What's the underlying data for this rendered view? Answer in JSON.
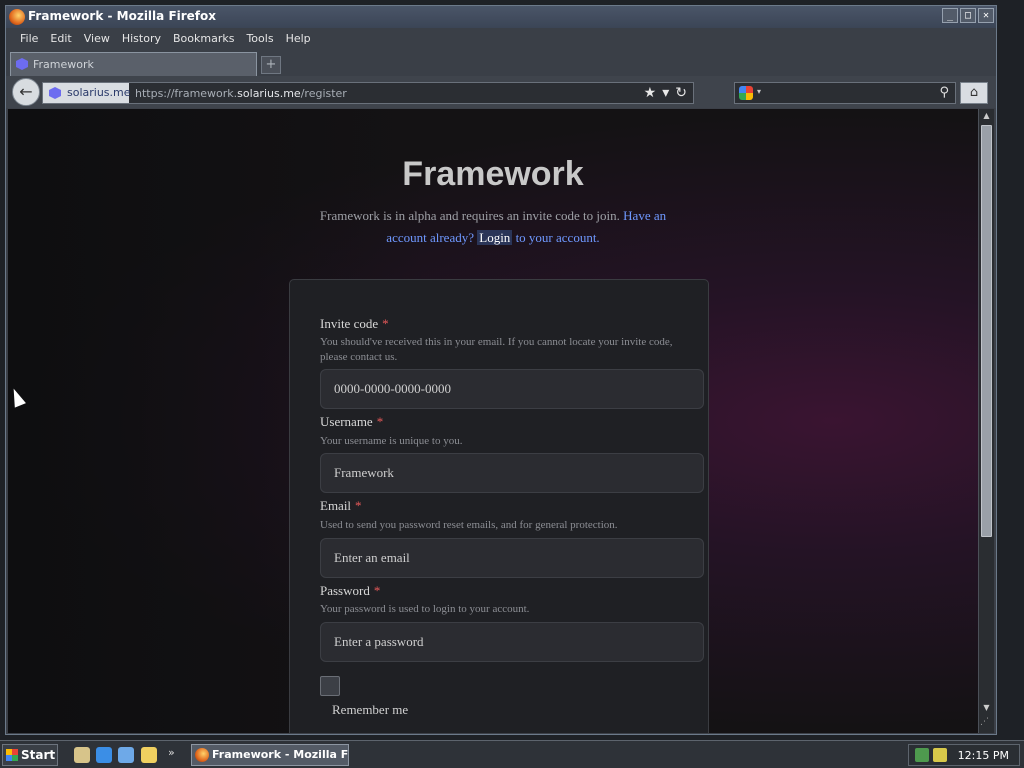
{
  "window": {
    "title": "Framework - Mozilla Firefox",
    "buttons": {
      "minimize": "_",
      "maximize": "□",
      "close": "✕"
    }
  },
  "menu": [
    "File",
    "Edit",
    "View",
    "History",
    "Bookmarks",
    "Tools",
    "Help"
  ],
  "tab": {
    "label": "Framework",
    "new_tab": "+"
  },
  "nav": {
    "back": "←",
    "site_identity": "solarius.me",
    "url_prefix": "https://framework.",
    "url_host": "solarius.me",
    "url_path": "/register",
    "bookmark_star": "★",
    "dropdown": "▾",
    "reload": "↻",
    "search_value": "",
    "search_go": "⚲",
    "home": "⌂"
  },
  "page": {
    "title": "Framework",
    "intro_text": "Framework is in alpha and requires an invite code to join.",
    "have_account": "Have an account already?",
    "login_link": "Login",
    "login_suffix": "to your account."
  },
  "form": {
    "invite": {
      "label": "Invite code",
      "required": "*",
      "help": "You should've received this in your email. If you cannot locate your invite code, please contact us.",
      "placeholder": "0000-0000-0000-0000"
    },
    "username": {
      "label": "Username",
      "required": "*",
      "help": "Your username is unique to you.",
      "placeholder": "Framework"
    },
    "email": {
      "label": "Email",
      "required": "*",
      "help": "Used to send you password reset emails, and for general protection.",
      "placeholder": "Enter an email"
    },
    "password": {
      "label": "Password",
      "required": "*",
      "help": "Your password is used to login to your account.",
      "placeholder": "Enter a password"
    },
    "remember_label": "Remember me",
    "remember_checked": false
  },
  "scrollbar": {
    "up": "▲",
    "down": "▼",
    "grip": "⋰"
  },
  "taskbar": {
    "start": "Start",
    "more": "»",
    "task_label": "Framework - Mozilla Fi...",
    "clock": "12:15 PM"
  },
  "colors": {
    "link": "#6f98ff",
    "required": "#e85a5a",
    "card_bg": "#1f2024",
    "page_accent": "#3a1431"
  }
}
